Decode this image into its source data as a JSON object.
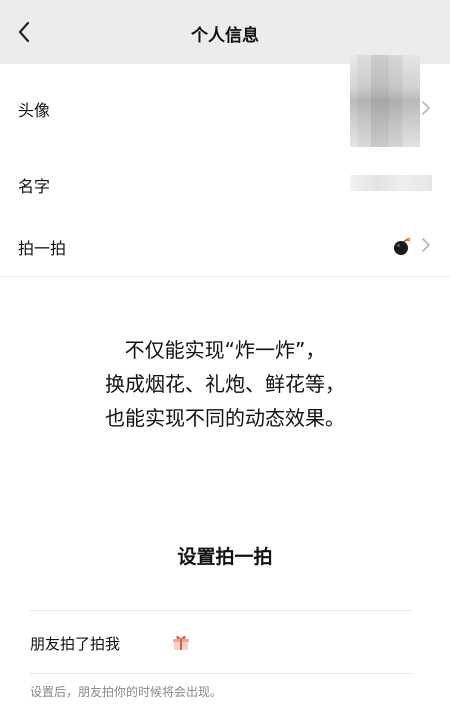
{
  "header": {
    "title": "个人信息",
    "back_icon": "chevron-left-icon"
  },
  "rows": {
    "avatar": {
      "label": "头像"
    },
    "name": {
      "label": "名字"
    },
    "pat": {
      "label": "拍一拍",
      "icon": "bomb-icon"
    }
  },
  "description": {
    "line1": "不仅能实现“炸一炸”，",
    "line2": "换成烟花、礼炮、鲜花等，",
    "line3": "也能实现不同的动态效果。"
  },
  "settings": {
    "title": "设置拍一拍",
    "row_label": "朋友拍了拍我",
    "row_icon": "gift-icon",
    "footnote": "设置后，朋友拍你的时候将会出现。"
  },
  "colors": {
    "header_bg": "#ececec",
    "divider": "#e8e8e8",
    "muted_text": "#888888"
  }
}
